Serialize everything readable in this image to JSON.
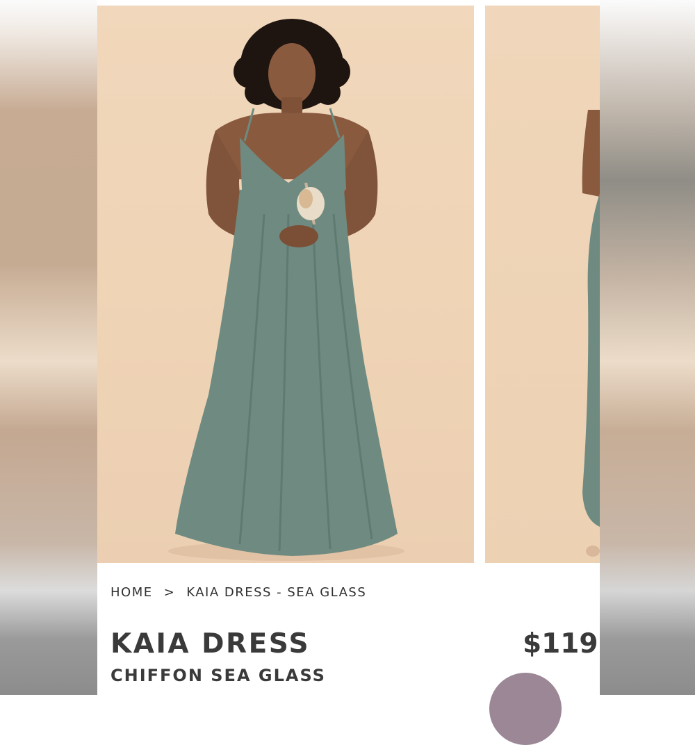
{
  "breadcrumb": {
    "home": "HOME",
    "separator": ">",
    "current": "KAIA DRESS - SEA GLASS"
  },
  "product": {
    "name": "KAIA DRESS",
    "variant": "CHIFFON SEA GLASS",
    "price": "$119",
    "swatch_color": "#9b8796"
  },
  "colors": {
    "backdrop": "#efd3b5",
    "dress": "#6f8b81",
    "text": "#3a3a3a"
  },
  "icons": {
    "breadcrumb_separator": "chevron-right-icon"
  }
}
